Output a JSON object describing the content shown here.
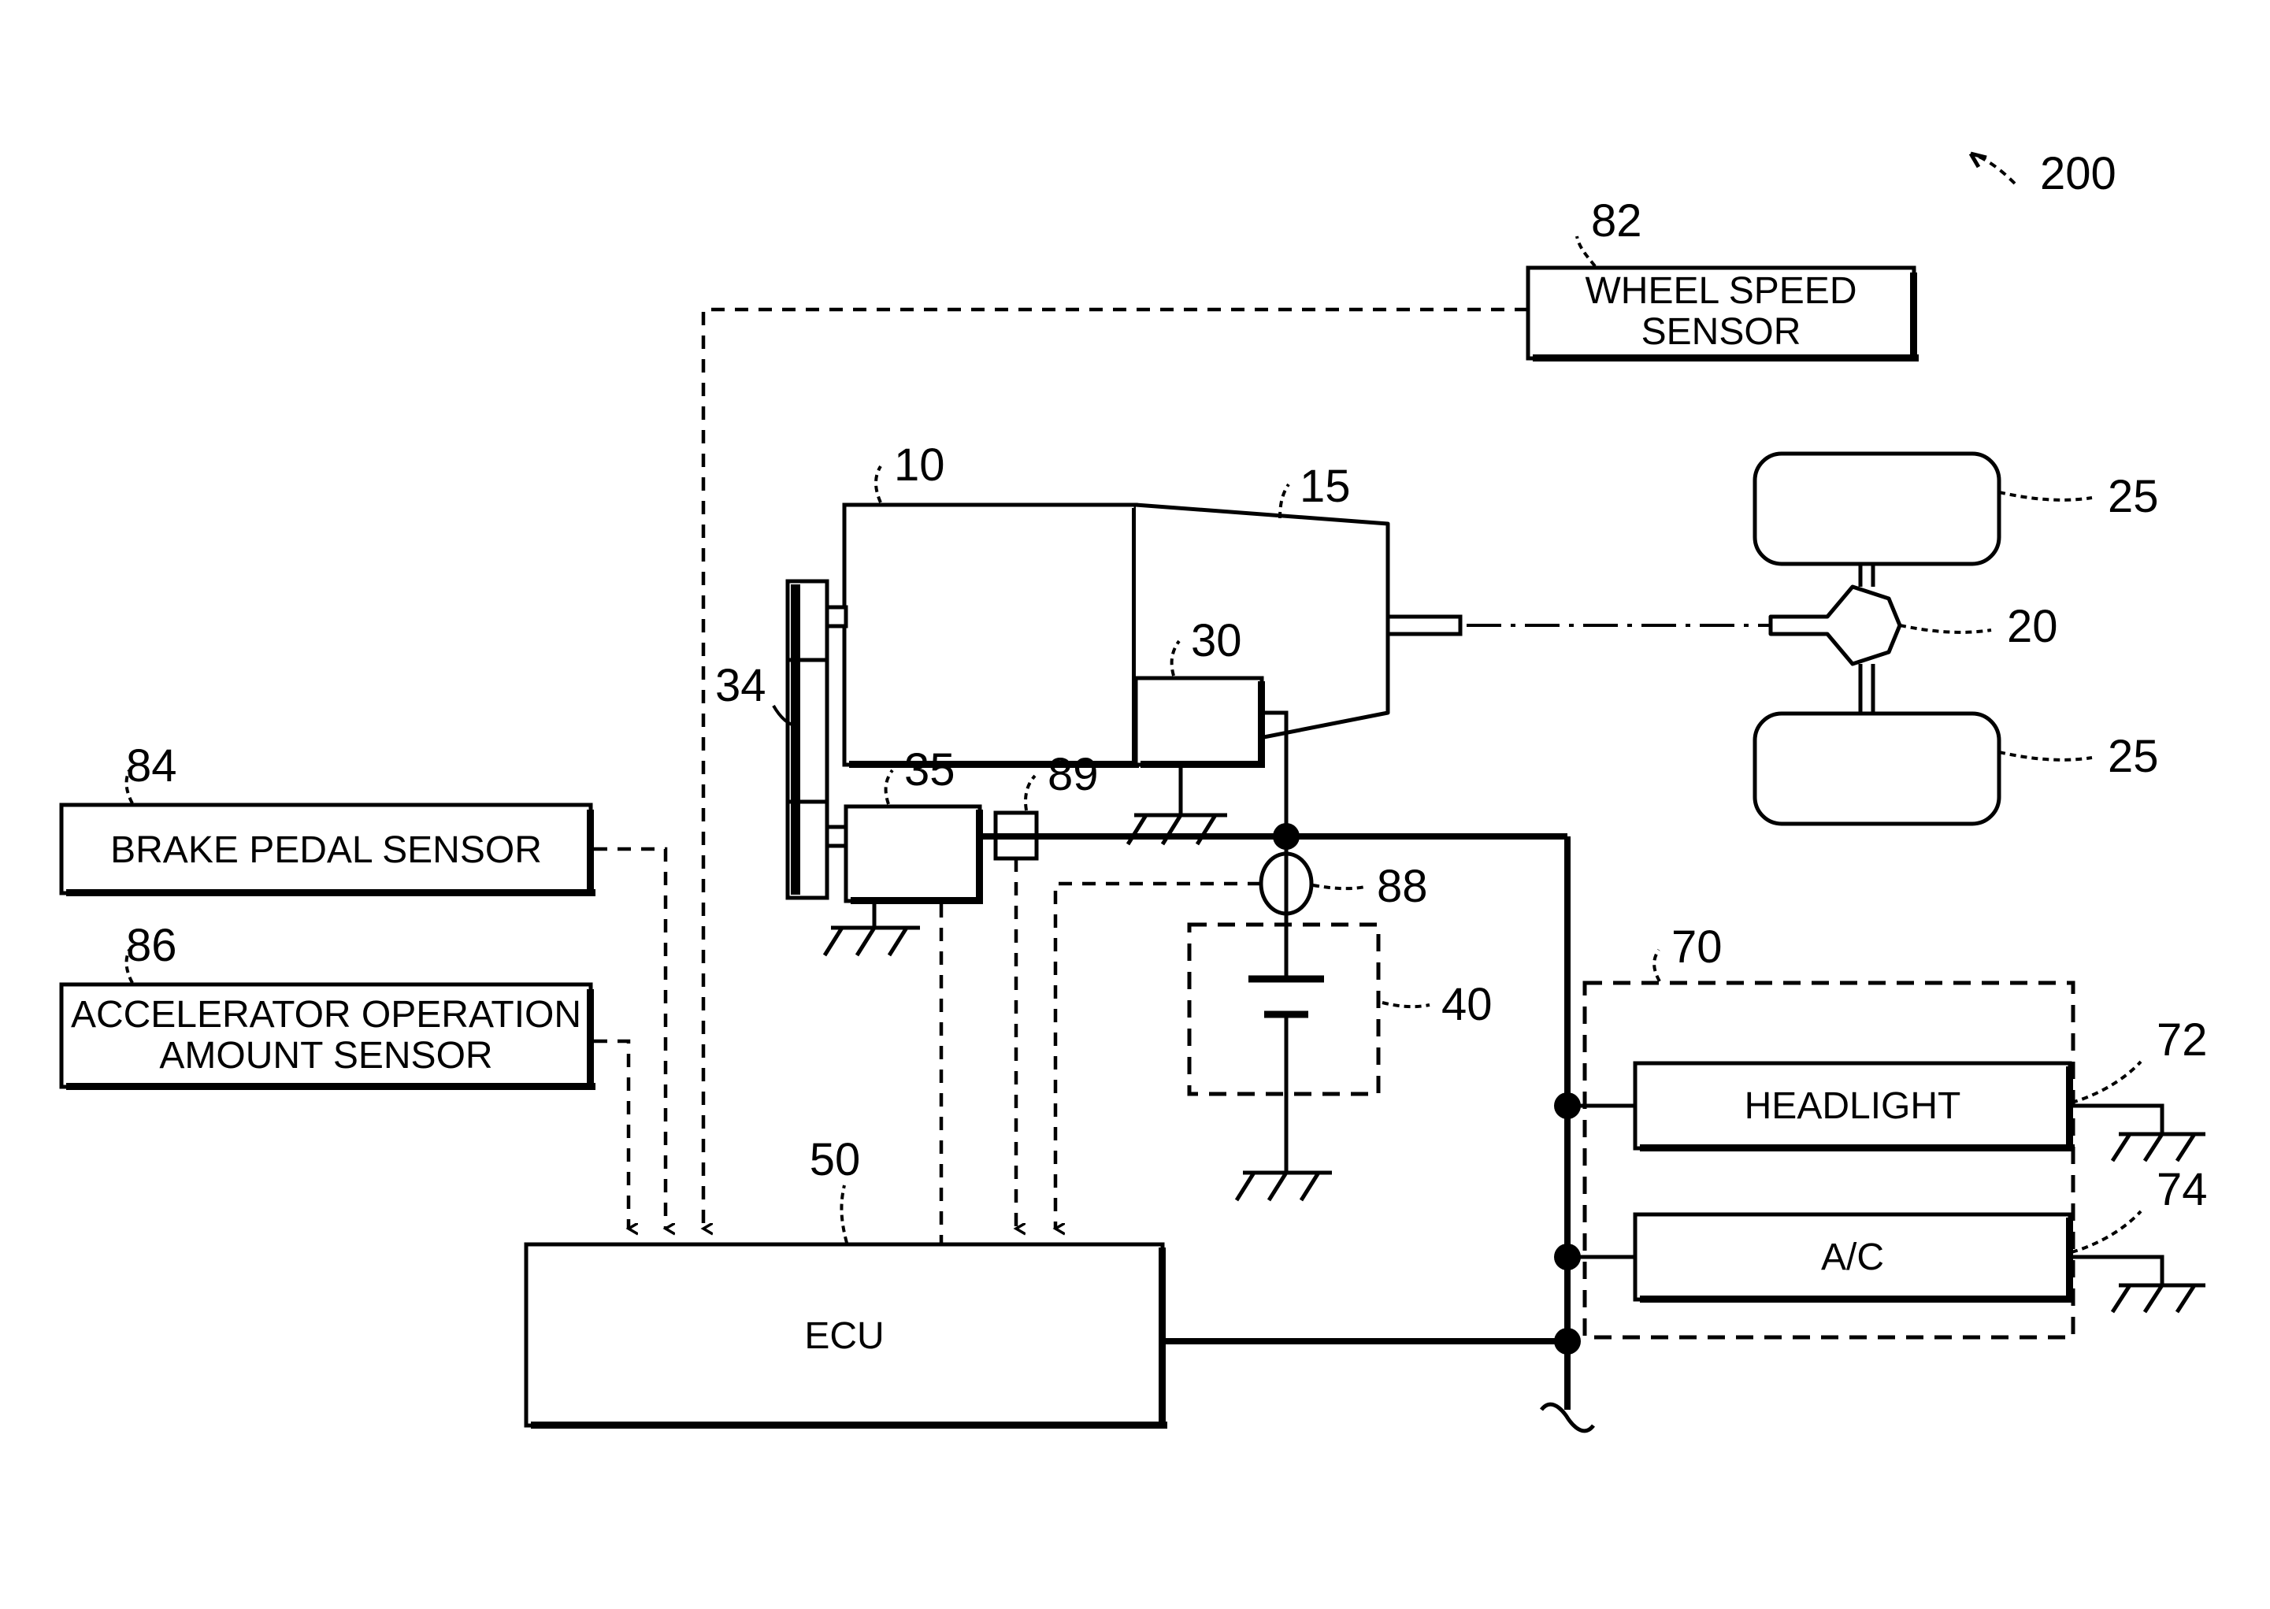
{
  "figure": {
    "system_ref": "200",
    "type": "electric-vehicle-drive-system-block-diagram"
  },
  "blocks": {
    "wheel_speed_sensor": {
      "ref": "82",
      "label_line1": "WHEEL SPEED",
      "label_line2": "SENSOR"
    },
    "brake_pedal_sensor": {
      "ref": "84",
      "label_line1": "BRAKE PEDAL SENSOR",
      "label_line2": ""
    },
    "accelerator_sensor": {
      "ref": "86",
      "label_line1": "ACCELERATOR OPERATION",
      "label_line2": "AMOUNT SENSOR"
    },
    "ecu": {
      "ref": "50",
      "label": "ECU"
    },
    "headlight": {
      "ref": "72",
      "label": "HEADLIGHT"
    },
    "air_conditioner": {
      "ref": "74",
      "label": "A/C"
    },
    "auxiliary_load_group": {
      "ref": "70",
      "label": ""
    },
    "motor": {
      "ref": "10",
      "label": ""
    },
    "reduction_gear": {
      "ref": "15",
      "label": ""
    },
    "differential": {
      "ref": "20",
      "label": ""
    },
    "wheel_upper": {
      "ref": "25",
      "label": ""
    },
    "wheel_lower": {
      "ref": "25",
      "label": ""
    },
    "inverter_or_converter": {
      "ref": "30",
      "label": ""
    },
    "field_coil_stack": {
      "ref": "34",
      "label": ""
    },
    "dcdc_or_driver": {
      "ref": "35",
      "label": ""
    },
    "battery": {
      "ref": "40",
      "label": ""
    },
    "current_sensor_battery": {
      "ref": "88",
      "label": ""
    },
    "current_sensor_line": {
      "ref": "89",
      "label": ""
    }
  },
  "colors": {
    "line": "#000000",
    "background": "#ffffff"
  }
}
